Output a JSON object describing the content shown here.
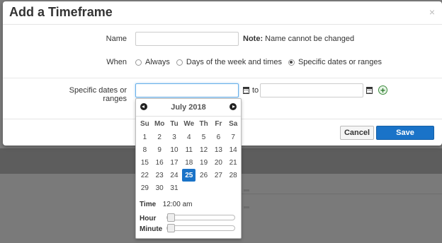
{
  "modal": {
    "title": "Add a Timeframe",
    "close_label": "×"
  },
  "form": {
    "name_label": "Name",
    "name_value": "",
    "note_bold": "Note:",
    "note_text": " Name cannot be changed",
    "when_label": "When",
    "when_options": [
      {
        "label": "Always",
        "checked": false
      },
      {
        "label": "Days of the week and times",
        "checked": false
      },
      {
        "label": "Specific dates or ranges",
        "checked": true
      }
    ],
    "dates_label": "Specific dates or ranges",
    "start_value": "",
    "to_label": "to",
    "end_value": "",
    "add_icon": "plus-circle-icon"
  },
  "footer": {
    "cancel_label": "Cancel",
    "save_label": "Save"
  },
  "datepicker": {
    "month_title": "July 2018",
    "weekdays": [
      "Su",
      "Mo",
      "Tu",
      "We",
      "Th",
      "Fr",
      "Sa"
    ],
    "days": [
      1,
      2,
      3,
      4,
      5,
      6,
      7,
      8,
      9,
      10,
      11,
      12,
      13,
      14,
      15,
      16,
      17,
      18,
      19,
      20,
      21,
      22,
      23,
      24,
      25,
      26,
      27,
      28,
      29,
      30,
      31
    ],
    "selected_day": 25,
    "time_label": "Time",
    "time_value": "12:00 am",
    "hour_label": "Hour",
    "minute_label": "Minute",
    "hour_level": 0,
    "minute_level": 0
  },
  "colors": {
    "accent": "#1a73c8",
    "add_green": "#2d7a2d"
  }
}
